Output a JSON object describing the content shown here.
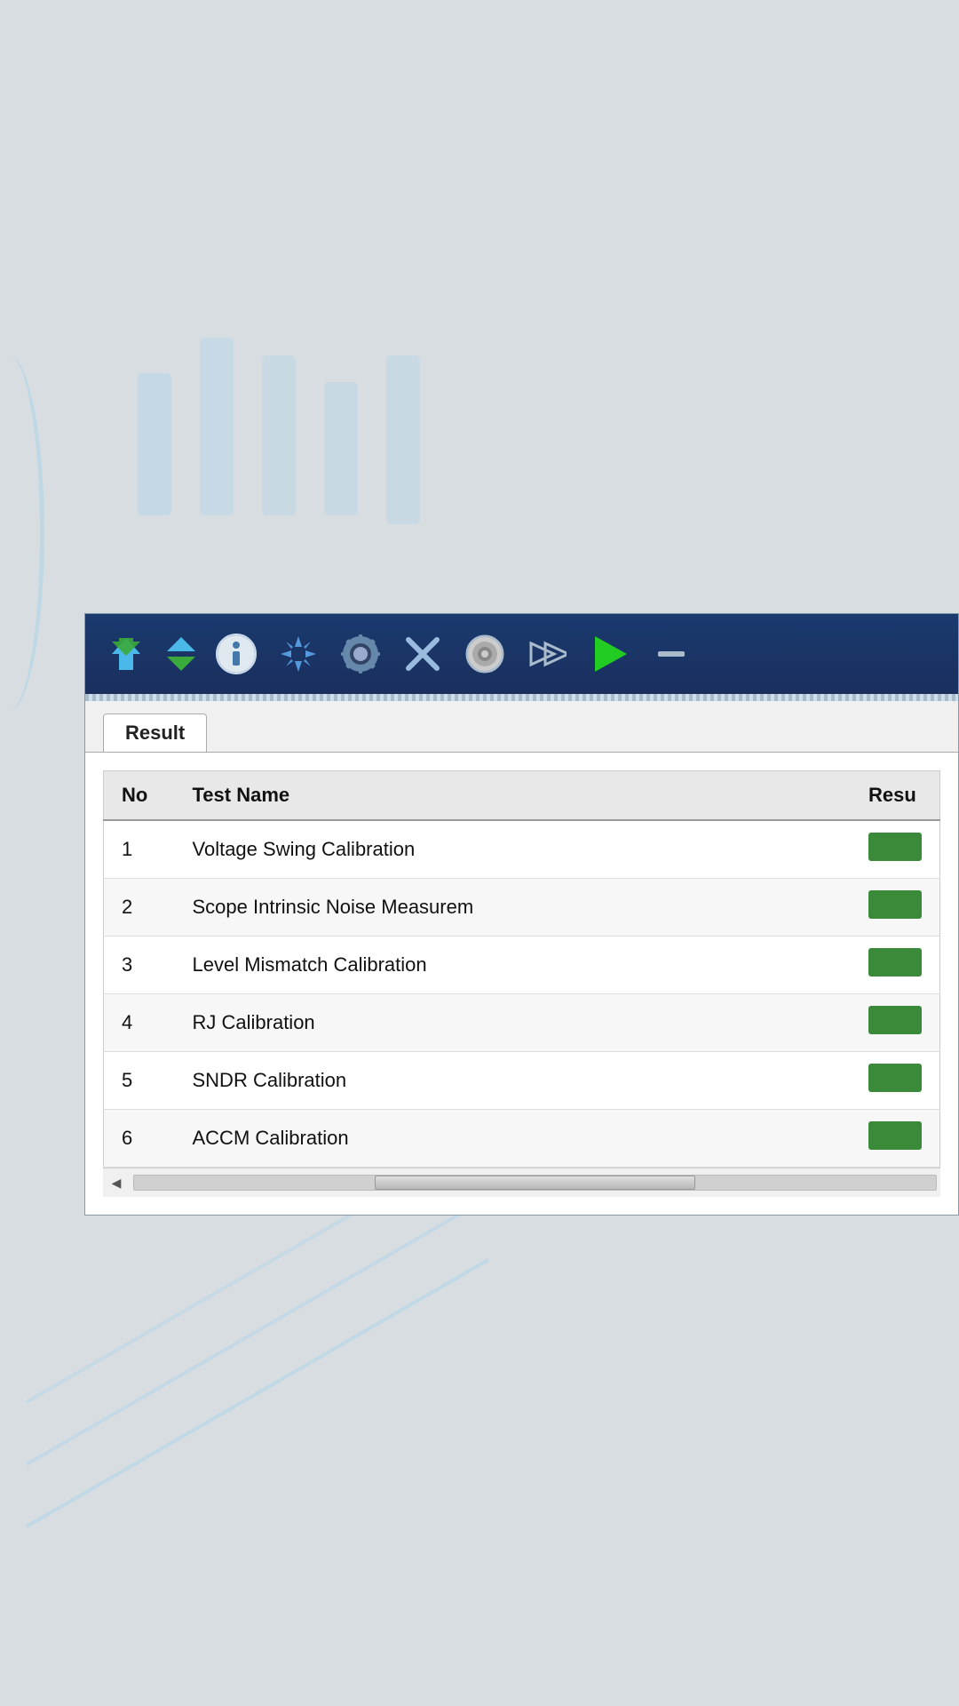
{
  "background": {
    "color": "#d8dde2"
  },
  "toolbar": {
    "icons": [
      {
        "name": "move-up-icon",
        "label": "Move Up"
      },
      {
        "name": "move-down-icon",
        "label": "Move Down"
      },
      {
        "name": "info-icon",
        "label": "Info"
      },
      {
        "name": "add-icon",
        "label": "Add"
      },
      {
        "name": "settings-icon",
        "label": "Settings"
      },
      {
        "name": "tools-icon",
        "label": "Tools"
      },
      {
        "name": "power-icon",
        "label": "Power"
      },
      {
        "name": "forward-icon",
        "label": "Forward"
      },
      {
        "name": "play-icon",
        "label": "Play"
      },
      {
        "name": "more-icon",
        "label": "More"
      }
    ]
  },
  "tabs": [
    {
      "label": "Result",
      "active": true
    }
  ],
  "table": {
    "columns": [
      {
        "key": "no",
        "label": "No"
      },
      {
        "key": "test_name",
        "label": "Test Name"
      },
      {
        "key": "result",
        "label": "Resu"
      }
    ],
    "rows": [
      {
        "no": "1",
        "test_name": "Voltage Swing Calibration",
        "result_status": "pass"
      },
      {
        "no": "2",
        "test_name": "Scope Intrinsic Noise Measurem",
        "result_status": "pass"
      },
      {
        "no": "3",
        "test_name": "Level Mismatch Calibration",
        "result_status": "pass"
      },
      {
        "no": "4",
        "test_name": "RJ Calibration",
        "result_status": "pass"
      },
      {
        "no": "5",
        "test_name": "SNDR Calibration",
        "result_status": "pass"
      },
      {
        "no": "6",
        "test_name": "ACCM Calibration",
        "result_status": "pass"
      }
    ]
  },
  "colors": {
    "pass_badge": "#3a8a3a",
    "toolbar_bg": "#1a3060",
    "header_bg": "#e8e8e8"
  }
}
